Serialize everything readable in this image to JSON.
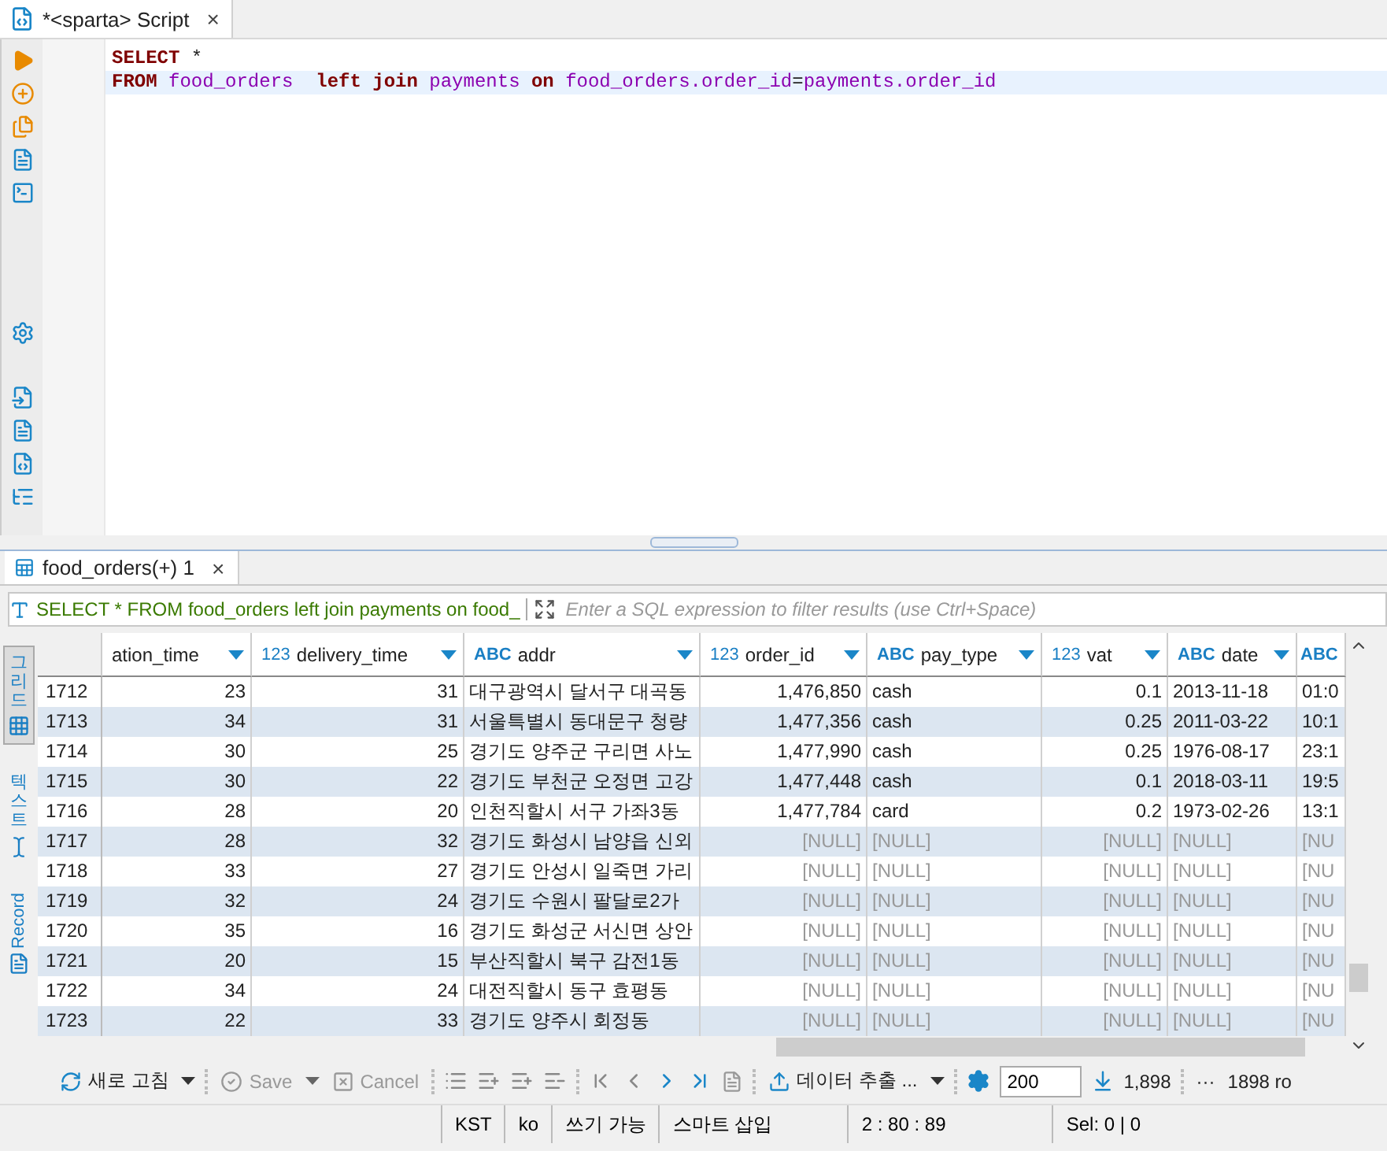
{
  "editor_tab": {
    "label": "*<sparta> Script",
    "close": "×"
  },
  "editor": {
    "lines": [
      {
        "current": false,
        "tokens": [
          {
            "kind": "keyword",
            "text": "SELECT"
          },
          {
            "kind": "plain",
            "text": " *"
          }
        ]
      },
      {
        "current": true,
        "tokens": [
          {
            "kind": "keyword",
            "text": "FROM"
          },
          {
            "kind": "ident",
            "text": " food_orders"
          },
          {
            "kind": "keyword",
            "text": "  left join"
          },
          {
            "kind": "ident",
            "text": " payments"
          },
          {
            "kind": "keyword",
            "text": " on"
          },
          {
            "kind": "ident",
            "text": " food_orders.order_id"
          },
          {
            "kind": "plain",
            "text": "="
          },
          {
            "kind": "ident",
            "text": "payments.order_id"
          }
        ]
      }
    ]
  },
  "results_tab": {
    "label": "food_orders(+) 1",
    "close": "×"
  },
  "filter": {
    "query": "SELECT * FROM food_orders left join payments on food_",
    "placeholder": "Enter a SQL expression to filter results (use Ctrl+Space)"
  },
  "side_tabs": [
    {
      "label": "그리드",
      "selected": true
    },
    {
      "label": "텍스트",
      "selected": false
    },
    {
      "label": "Record",
      "selected": false
    }
  ],
  "table": {
    "columns": [
      {
        "kind": "number",
        "name": "ation_time"
      },
      {
        "kind": "number",
        "type_tag": "123",
        "name": "delivery_time"
      },
      {
        "kind": "text",
        "type_tag": "ABC",
        "name": "addr"
      },
      {
        "kind": "number",
        "type_tag": "123",
        "name": "order_id"
      },
      {
        "kind": "text",
        "type_tag": "ABC",
        "name": "pay_type"
      },
      {
        "kind": "number",
        "type_tag": "123",
        "name": "vat"
      },
      {
        "kind": "text",
        "type_tag": "ABC",
        "name": "date"
      },
      {
        "kind": "text",
        "type_tag": "ABC"
      }
    ],
    "rows": [
      {
        "num": "1712",
        "matched": true,
        "cells": [
          "23",
          "31",
          "대구광역시 달서구 대곡동",
          "1,476,850",
          "cash",
          "0.1",
          "2013-11-18",
          "01:0"
        ]
      },
      {
        "num": "1713",
        "matched": true,
        "cells": [
          "34",
          "31",
          "서울특별시 동대문구 청량",
          "1,477,356",
          "cash",
          "0.25",
          "2011-03-22",
          "10:1"
        ]
      },
      {
        "num": "1714",
        "matched": true,
        "cells": [
          "30",
          "25",
          "경기도 양주군 구리면 사노",
          "1,477,990",
          "cash",
          "0.25",
          "1976-08-17",
          "23:1"
        ]
      },
      {
        "num": "1715",
        "matched": true,
        "cells": [
          "30",
          "22",
          "경기도 부천군 오정면 고강",
          "1,477,448",
          "cash",
          "0.1",
          "2018-03-11",
          "19:5"
        ]
      },
      {
        "num": "1716",
        "matched": true,
        "cells": [
          "28",
          "20",
          "인천직할시 서구 가좌3동",
          "1,477,784",
          "card",
          "0.2",
          "1973-02-26",
          "13:1"
        ]
      },
      {
        "num": "1717",
        "matched": false,
        "cells": [
          "28",
          "32",
          "경기도 화성시 남양읍 신외",
          "[NULL]",
          "[NULL]",
          "[NULL]",
          "[NULL]",
          "[NU"
        ]
      },
      {
        "num": "1718",
        "matched": false,
        "cells": [
          "33",
          "27",
          "경기도 안성시 일죽면 가리",
          "[NULL]",
          "[NULL]",
          "[NULL]",
          "[NULL]",
          "[NU"
        ]
      },
      {
        "num": "1719",
        "matched": false,
        "cells": [
          "32",
          "24",
          "경기도 수원시 팔달로2가",
          "[NULL]",
          "[NULL]",
          "[NULL]",
          "[NULL]",
          "[NU"
        ]
      },
      {
        "num": "1720",
        "matched": false,
        "cells": [
          "35",
          "16",
          "경기도 화성군 서신면 상안",
          "[NULL]",
          "[NULL]",
          "[NULL]",
          "[NULL]",
          "[NU"
        ]
      },
      {
        "num": "1721",
        "matched": false,
        "cells": [
          "20",
          "15",
          "부산직할시 북구 감전1동",
          "[NULL]",
          "[NULL]",
          "[NULL]",
          "[NULL]",
          "[NU"
        ]
      },
      {
        "num": "1722",
        "matched": false,
        "cells": [
          "34",
          "24",
          "대전직할시 동구 효평동",
          "[NULL]",
          "[NULL]",
          "[NULL]",
          "[NULL]",
          "[NU"
        ]
      },
      {
        "num": "1723",
        "matched": false,
        "cells": [
          "22",
          "33",
          "경기도 양주시 회정동",
          "[NULL]",
          "[NULL]",
          "[NULL]",
          "[NULL]",
          "[NU"
        ]
      }
    ]
  },
  "toolbar": {
    "refresh": "새로 고침",
    "save": {
      "label": "Save",
      "disabled": true
    },
    "cancel": {
      "label": "Cancel",
      "disabled": true
    },
    "export": "데이터 추출 ...",
    "fetch_size": "200",
    "fetched": "1,898",
    "more": "···",
    "row_count": "1898 ro"
  },
  "status_bar": [
    "KST",
    "ko",
    "쓰기 가능",
    "스마트 삽입",
    "2 : 80 : 89",
    "Sel: 0 | 0"
  ]
}
